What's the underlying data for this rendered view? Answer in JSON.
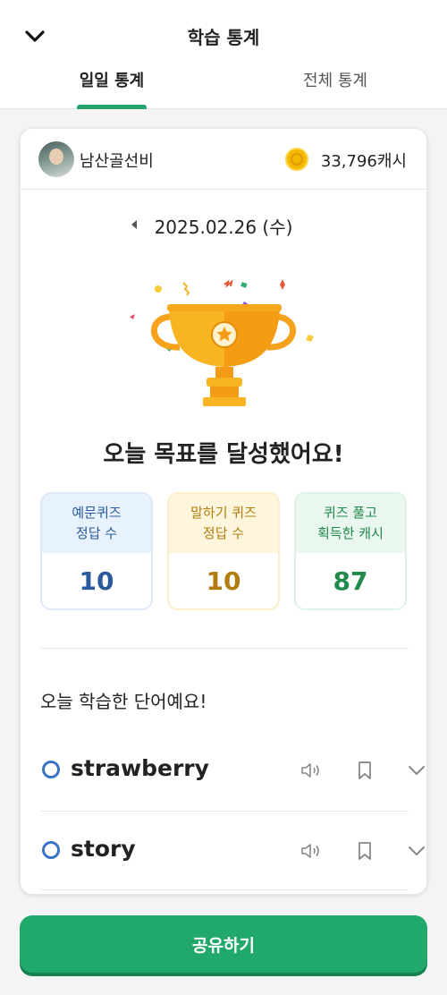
{
  "header": {
    "title": "학습 통계",
    "tabs": [
      {
        "label": "일일 통계",
        "active": true
      },
      {
        "label": "전체 통계",
        "active": false
      }
    ],
    "accent_color": "#21a36a"
  },
  "profile": {
    "username": "남산골선비",
    "cash": "33,796캐시"
  },
  "date": "2025.02.26 (수)",
  "goal_message": "오늘 목표를 달성했어요!",
  "stats": [
    {
      "label_line1": "예문퀴즈",
      "label_line2": "정답 수",
      "value": "10",
      "color": "#2a5a9a"
    },
    {
      "label_line1": "말하기 퀴즈",
      "label_line2": "정답 수",
      "value": "10",
      "color": "#b27c0e"
    },
    {
      "label_line1": "퀴즈 풀고",
      "label_line2": "획득한 캐시",
      "value": "87",
      "color": "#218a4c"
    }
  ],
  "words_section": {
    "title": "오늘 학습한 단어예요!",
    "words": [
      {
        "word": "strawberry"
      },
      {
        "word": "story"
      }
    ]
  },
  "share_button": "공유하기"
}
